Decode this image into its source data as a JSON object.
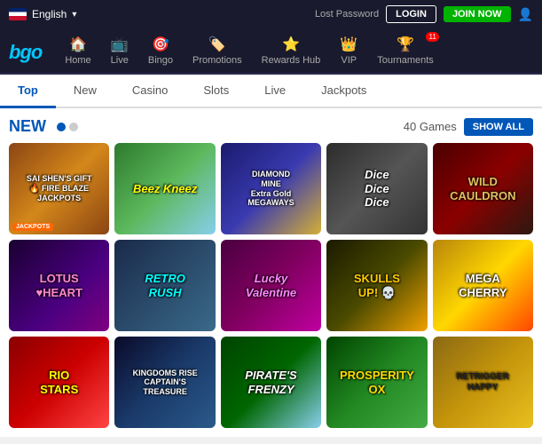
{
  "header": {
    "language": "English",
    "lost_password": "Lost Password",
    "login_label": "LOGIN",
    "join_label": "JOIN NOW"
  },
  "nav": {
    "logo": "bgo",
    "items": [
      {
        "id": "home",
        "label": "Home",
        "icon": "🏠",
        "active": false
      },
      {
        "id": "live",
        "label": "Live",
        "icon": "📺",
        "active": false
      },
      {
        "id": "bingo",
        "label": "Bingo",
        "icon": "🎯",
        "active": false
      },
      {
        "id": "promotions",
        "label": "Promotions",
        "icon": "🏷️",
        "active": false
      },
      {
        "id": "rewards",
        "label": "Rewards Hub",
        "icon": "⭐",
        "active": false
      },
      {
        "id": "vip",
        "label": "VIP",
        "icon": "👑",
        "active": false
      },
      {
        "id": "tournaments",
        "label": "Tournaments",
        "icon": "🏆",
        "active": false,
        "badge": "11"
      }
    ]
  },
  "tabs": [
    {
      "id": "top",
      "label": "Top",
      "active": true
    },
    {
      "id": "new",
      "label": "New",
      "active": false
    },
    {
      "id": "casino",
      "label": "Casino",
      "active": false
    },
    {
      "id": "slots",
      "label": "Slots",
      "active": false
    },
    {
      "id": "live",
      "label": "Live",
      "active": false
    },
    {
      "id": "jackpots",
      "label": "Jackpots",
      "active": false
    }
  ],
  "section": {
    "title": "NEW",
    "games_count": "40 Games",
    "show_all_label": "SHOW ALL"
  },
  "games": [
    {
      "id": "sai",
      "name": "SAI SHEN'S GIFT FIRE BLAZE JACKPOTS",
      "style": "game-sai",
      "has_jackpot": true
    },
    {
      "id": "beez",
      "name": "Beez Kneez",
      "style": "game-beez"
    },
    {
      "id": "diamond",
      "name": "DIAMOND MINE Extra Gold MEGAWAYS",
      "style": "game-diamond"
    },
    {
      "id": "dice",
      "name": "Dice Dice Dice",
      "style": "game-dice"
    },
    {
      "id": "wild",
      "name": "WILD CAULDRON",
      "style": "game-wild"
    },
    {
      "id": "lotus",
      "name": "LOTUS♥HEART",
      "style": "game-lotus"
    },
    {
      "id": "retro",
      "name": "RETRO RUSH",
      "style": "game-retro"
    },
    {
      "id": "lucky",
      "name": "Lucky Valentine",
      "style": "game-lucky"
    },
    {
      "id": "skulls",
      "name": "SKULLS UP!",
      "style": "game-skulls"
    },
    {
      "id": "mega",
      "name": "MEGA CHERRY",
      "style": "game-mega"
    },
    {
      "id": "rio",
      "name": "RIO STARS",
      "style": "game-rio"
    },
    {
      "id": "captains",
      "name": "KINGDOMS RISE CAPTAIN'S TREASURE",
      "style": "game-captains"
    },
    {
      "id": "pirates",
      "name": "PIRATE'S FRENZY",
      "style": "game-pirates"
    },
    {
      "id": "prosperity",
      "name": "PROSPERITY OX",
      "style": "game-prosperity"
    },
    {
      "id": "retrigger",
      "name": "RETRIGGER HAPPY",
      "style": "game-retrigger"
    }
  ]
}
